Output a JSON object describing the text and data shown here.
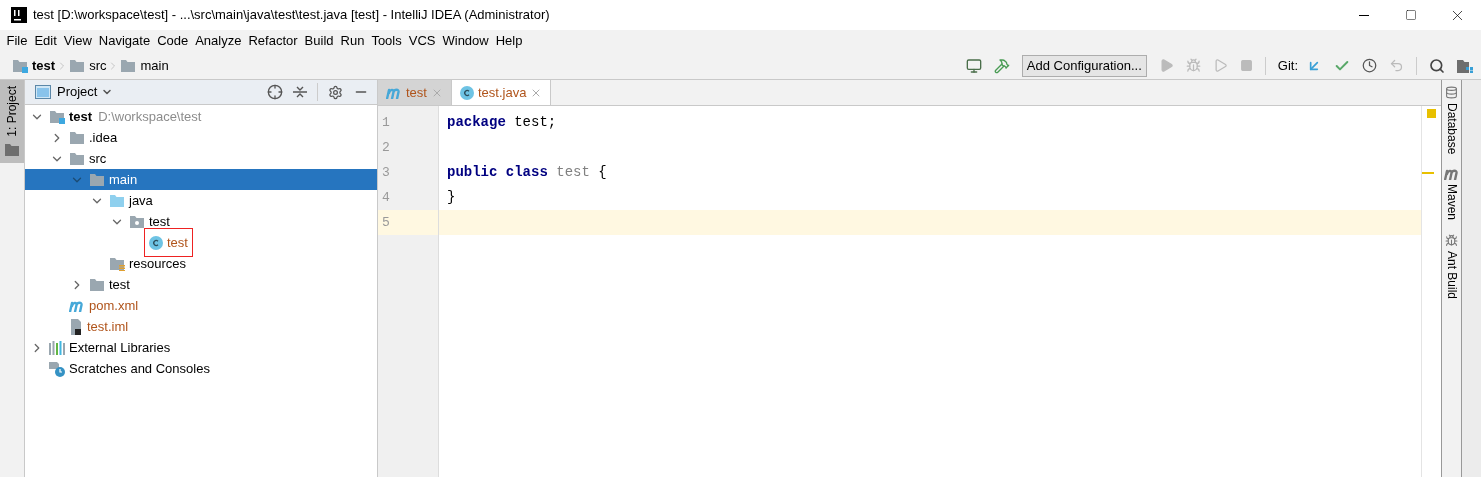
{
  "window": {
    "title": "test [D:\\workspace\\test] - ...\\src\\main\\java\\test\\test.java [test] - IntelliJ IDEA (Administrator)"
  },
  "menu": [
    "File",
    "Edit",
    "View",
    "Navigate",
    "Code",
    "Analyze",
    "Refactor",
    "Build",
    "Run",
    "Tools",
    "VCS",
    "Window",
    "Help"
  ],
  "breadcrumbs": [
    {
      "label": "test",
      "kind": "module"
    },
    {
      "label": "src",
      "kind": "folder"
    },
    {
      "label": "main",
      "kind": "folder"
    }
  ],
  "toolbar": {
    "run_config": "Add Configuration...",
    "git_label": "Git:"
  },
  "left_strip": {
    "label": "1: Project"
  },
  "project_panel": {
    "title": "Project",
    "tree": [
      {
        "label": "test",
        "hint": "D:\\workspace\\test",
        "kind": "module",
        "expanded": true,
        "selected": false,
        "children": [
          {
            "label": ".idea",
            "kind": "folder",
            "expanded": false,
            "selected": false
          },
          {
            "label": "src",
            "kind": "folder",
            "expanded": true,
            "selected": false,
            "children": [
              {
                "label": "main",
                "kind": "folder",
                "expanded": true,
                "selected": true,
                "children": [
                  {
                    "label": "java",
                    "kind": "source",
                    "expanded": true,
                    "selected": false,
                    "children": [
                      {
                        "label": "test",
                        "kind": "package",
                        "expanded": true,
                        "selected": false,
                        "children": [
                          {
                            "label": "test",
                            "kind": "class",
                            "selected": false,
                            "highlighted": true,
                            "color": "#b0541b"
                          }
                        ]
                      }
                    ]
                  },
                  {
                    "label": "resources",
                    "kind": "resources",
                    "selected": false
                  }
                ]
              },
              {
                "label": "test",
                "kind": "folder",
                "expanded": false,
                "selected": false
              }
            ]
          },
          {
            "label": "pom.xml",
            "kind": "maven",
            "selected": false,
            "color": "#b0541b"
          },
          {
            "label": "test.iml",
            "kind": "iml",
            "selected": false,
            "color": "#b0541b"
          }
        ]
      },
      {
        "label": "External Libraries",
        "kind": "libraries",
        "expanded": false,
        "selected": false
      },
      {
        "label": "Scratches and Consoles",
        "kind": "scratches",
        "selected": false
      }
    ]
  },
  "editor": {
    "tabs": [
      {
        "label": "test",
        "kind": "maven",
        "selected": false
      },
      {
        "label": "test.java",
        "kind": "class",
        "selected": true
      }
    ],
    "lines": [
      {
        "number": "1",
        "current": false,
        "tokens": [
          {
            "text": "package",
            "kind": "keyword"
          },
          {
            "text": " test;",
            "kind": "plain"
          }
        ]
      },
      {
        "number": "2",
        "current": false
      },
      {
        "number": "3",
        "current": false,
        "tokens": [
          {
            "text": "public class",
            "kind": "keyword"
          },
          {
            "text": " test",
            "kind": "unused"
          },
          {
            "text": " {",
            "kind": "plain"
          }
        ]
      },
      {
        "number": "4",
        "current": false,
        "tokens": [
          {
            "text": "}",
            "kind": "plain"
          }
        ]
      },
      {
        "number": "5",
        "current": true
      }
    ]
  },
  "right_strip": [
    {
      "label": "Database",
      "kind": "database"
    },
    {
      "label": "Maven",
      "kind": "maven"
    },
    {
      "label": "Ant Build",
      "kind": "ant"
    }
  ]
}
